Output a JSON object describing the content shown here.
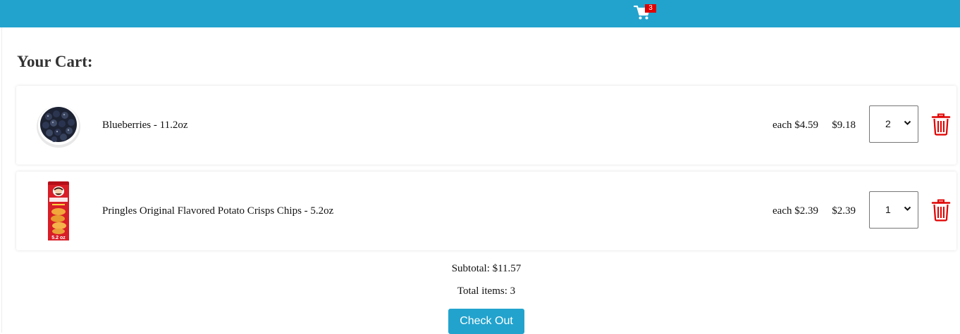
{
  "header": {
    "cart_icon": "shopping-cart-icon",
    "cart_count": "3",
    "bar_color": "#22a3cd",
    "badge_color": "#e00000"
  },
  "cart": {
    "title": "Your Cart:",
    "items": [
      {
        "image": "blueberries-product-image",
        "name": "Blueberries - 11.2oz",
        "each": "each $4.59",
        "total": "$9.18",
        "quantity": "2"
      },
      {
        "image": "pringles-product-image",
        "image_text": "5.2 oz",
        "name": "Pringles Original Flavored Potato Crisps Chips - 5.2oz",
        "each": "each $2.39",
        "total": "$2.39",
        "quantity": "1"
      }
    ],
    "delete_icon": "trash-icon",
    "delete_color": "#e00000"
  },
  "summary": {
    "subtotal": "Subtotal: $11.57",
    "total_items": "Total items: 3",
    "checkout_label": "Check Out"
  }
}
